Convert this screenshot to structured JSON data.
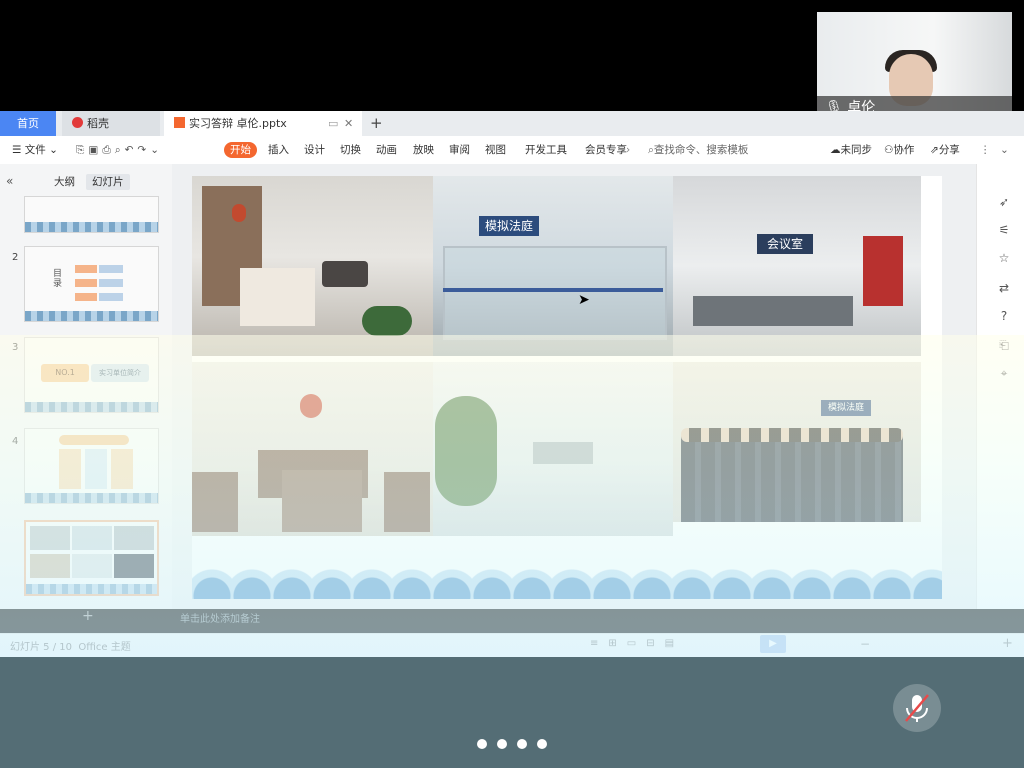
{
  "tabs": {
    "home": "首页",
    "daoke": "稻壳",
    "doc": "实习答辩 卓伦.pptx",
    "new_tab": "+"
  },
  "menu": {
    "file": "文件",
    "start": "开始",
    "items": [
      "插入",
      "设计",
      "切换",
      "动画",
      "放映",
      "审阅",
      "视图",
      "开发工具",
      "会员专享"
    ],
    "search": "查找命令、搜索模板",
    "unsynced": "未同步",
    "collab": "协作",
    "share": "分享"
  },
  "left_panel": {
    "outline": "大纲",
    "slides": "幻灯片",
    "thumbs": [
      {
        "num": "2",
        "caption": "目录"
      },
      {
        "num": "3",
        "caption": "NO.1",
        "sub": "实习单位简介"
      },
      {
        "num": "4",
        "caption": ""
      }
    ],
    "add": "+"
  },
  "slide": {
    "sign_court": "模拟法庭",
    "sign_meeting": "会议室",
    "sign_court2": "模拟法庭"
  },
  "status": {
    "notes": "单击此处添加备注",
    "count": "幻灯片 5 / 10",
    "theme": "Office 主题"
  },
  "camera": {
    "name": "卓伦"
  },
  "colors": {
    "accent": "#4b86f3",
    "start_tab": "#f4672f",
    "meeting_bar": "#546d75"
  }
}
